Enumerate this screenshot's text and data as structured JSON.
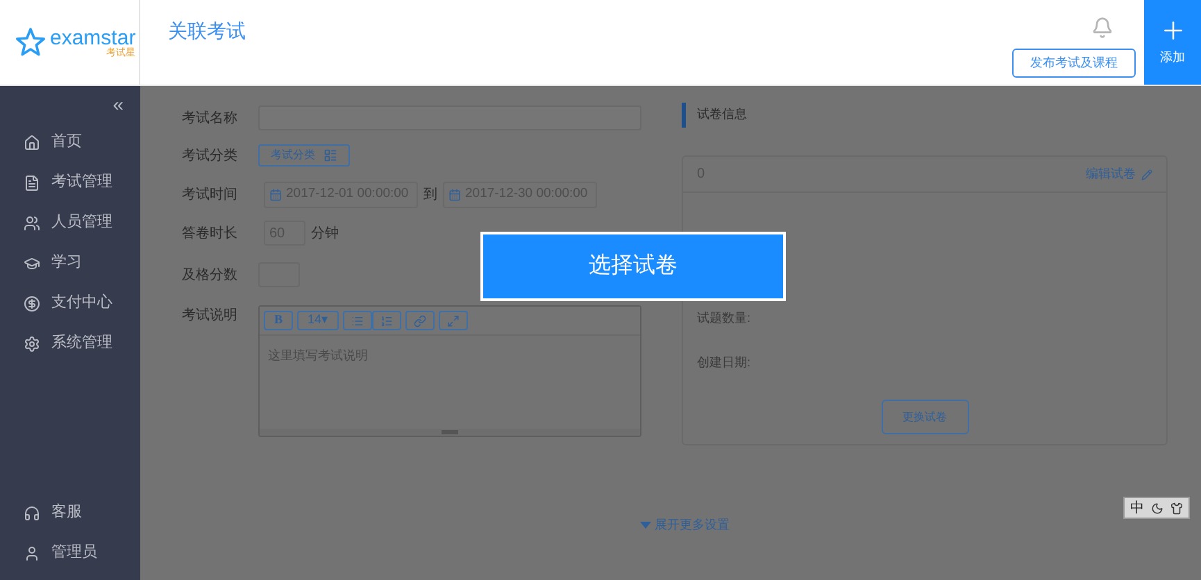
{
  "header": {
    "logo_text": "examstar",
    "logo_sub": "考试星",
    "title": "关联考试",
    "publish_button": "发布考试及课程",
    "add_button": "添加"
  },
  "sidebar": {
    "collapse": "«",
    "items": [
      {
        "label": "首页"
      },
      {
        "label": "考试管理"
      },
      {
        "label": "人员管理"
      },
      {
        "label": "学习"
      },
      {
        "label": "支付中心"
      },
      {
        "label": "系统管理"
      }
    ],
    "bottom_items": [
      {
        "label": "客服"
      },
      {
        "label": "管理员"
      }
    ]
  },
  "form": {
    "name_label": "考试名称",
    "category_label": "考试分类",
    "category_button": "考试分类",
    "time_label": "考试时间",
    "start_time": "2017-12-01 00:00:00",
    "to": "到",
    "end_time": "2017-12-30 00:00:00",
    "duration_label": "答卷时长",
    "duration": "60",
    "duration_unit": "分钟",
    "pass_label": "及格分数",
    "desc_label": "考试说明",
    "toolbar": {
      "bold": "B",
      "size": "14▾"
    },
    "desc_placeholder": "这里填写考试说明",
    "expand": "展开更多设置"
  },
  "paper": {
    "section_title": "试卷信息",
    "name": "0",
    "edit_link": "编辑试卷",
    "count_label": "试题数量:",
    "date_label": "创建日期:",
    "change_button": "更换试卷"
  },
  "modal_button": "选择试卷",
  "ime": {
    "label": "中"
  }
}
